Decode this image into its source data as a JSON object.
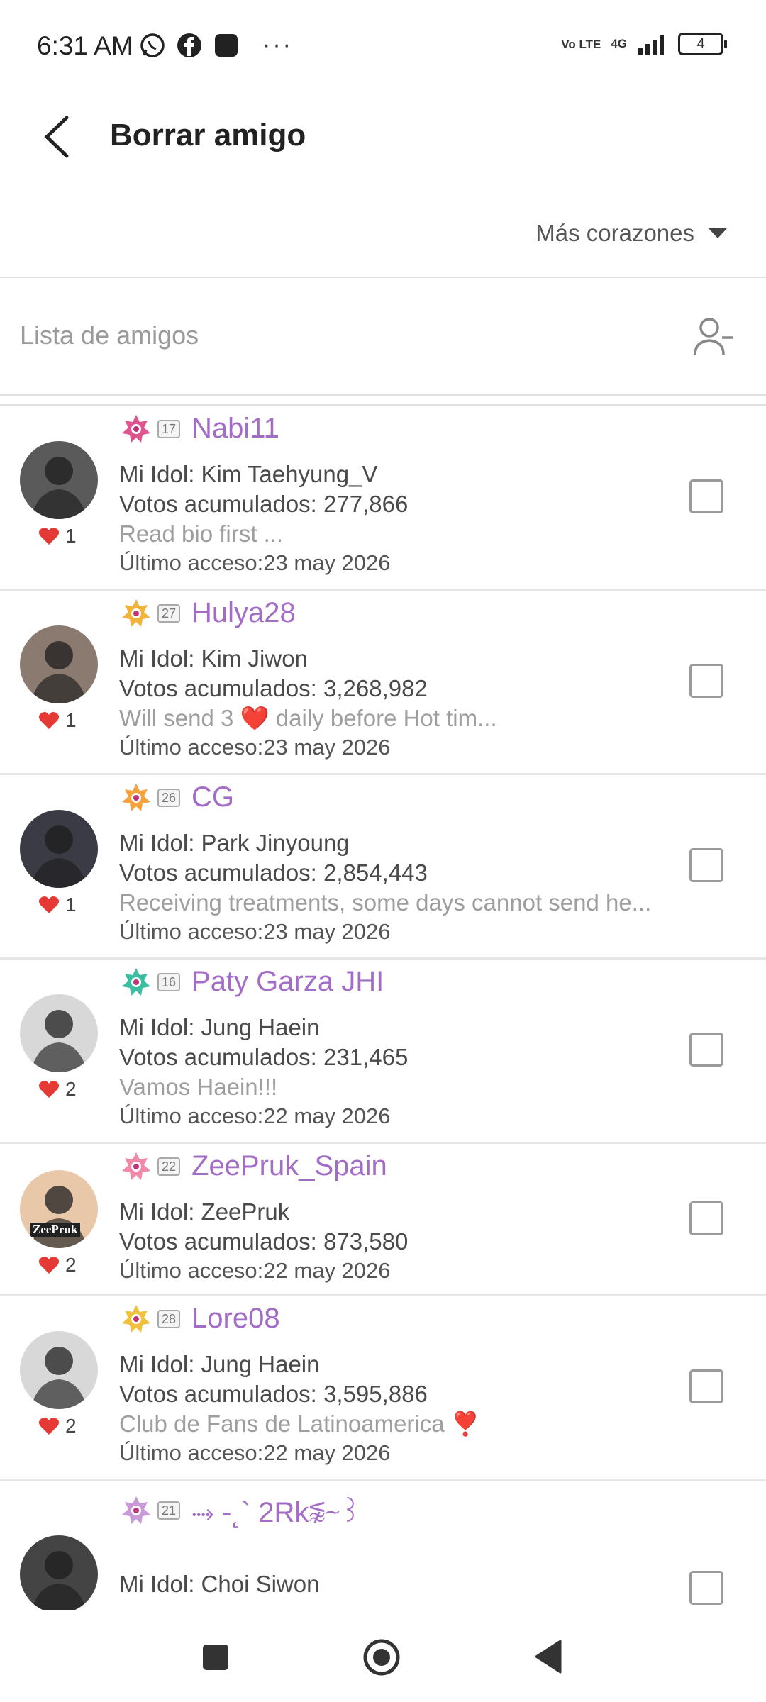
{
  "status_bar": {
    "time": "6:31 AM",
    "icons_left": [
      "whatsapp-icon",
      "facebook-icon",
      "app-icon"
    ],
    "more": "···",
    "network": "4G",
    "volte": "Vo LTE",
    "battery": "4"
  },
  "header": {
    "title": "Borrar amigo"
  },
  "sort": {
    "label": "Más corazones"
  },
  "list_header": {
    "title": "Lista de amigos"
  },
  "friends": [
    {
      "name": "Nabi11",
      "level": "17",
      "idol": "Mi Idol: Kim Taehyung_V",
      "votes": "Votos acumulados: 277,866",
      "bio": "Read bio first ...",
      "access": "Último acceso:23 may 2026",
      "hearts": "1",
      "avatar_color": "#5a5a5a",
      "badge_color": "#e05590"
    },
    {
      "name": "Hulya28",
      "level": "27",
      "idol": "Mi Idol: Kim Jiwon",
      "votes": "Votos acumulados: 3,268,982",
      "bio": "Will send 3 ❤️ daily before Hot tim...",
      "access": "Último acceso:23 may 2026",
      "hearts": "1",
      "avatar_color": "#8a7a70",
      "badge_color": "#f0b43c"
    },
    {
      "name": "CG",
      "level": "26",
      "idol": "Mi Idol: Park Jinyoung",
      "votes": "Votos acumulados: 2,854,443",
      "bio": "Receiving treatments, some days cannot send he...",
      "access": "Último acceso:23 may 2026",
      "hearts": "1",
      "avatar_color": "#3b3b45",
      "badge_color": "#f5a23c"
    },
    {
      "name": "Paty Garza JHI",
      "level": "16",
      "idol": "Mi Idol: Jung Haein",
      "votes": "Votos acumulados: 231,465",
      "bio": "Vamos Haein!!!",
      "access": "Último acceso:22 may 2026",
      "hearts": "2",
      "avatar_color": "#d8d8d8",
      "badge_color": "#3cbfa0"
    },
    {
      "name": "ZeePruk_Spain",
      "level": "22",
      "idol": "Mi Idol: ZeePruk",
      "votes": "Votos acumulados: 873,580",
      "bio": "",
      "access": "Último acceso:22 may 2026",
      "hearts": "2",
      "avatar_color": "#e8c8a8",
      "badge_color": "#f08aa8"
    },
    {
      "name": "Lore08",
      "level": "28",
      "idol": "Mi Idol: Jung Haein",
      "votes": "Votos acumulados: 3,595,886",
      "bio": "Club de Fans de Latinoamerica ❣️",
      "access": "Último acceso:22 may 2026",
      "hearts": "2",
      "avatar_color": "#d8d8d8",
      "badge_color": "#f0c23c"
    },
    {
      "name": "⤑ -˛` 2Rk⪉⁓꒱",
      "level": "21",
      "idol": "Mi Idol: Choi Siwon",
      "votes": "",
      "bio": "",
      "access": "",
      "hearts": "",
      "avatar_color": "#444444",
      "badge_color": "#c89ad8"
    }
  ],
  "avatar_text": {
    "zeepruk": "ZeePruk"
  }
}
